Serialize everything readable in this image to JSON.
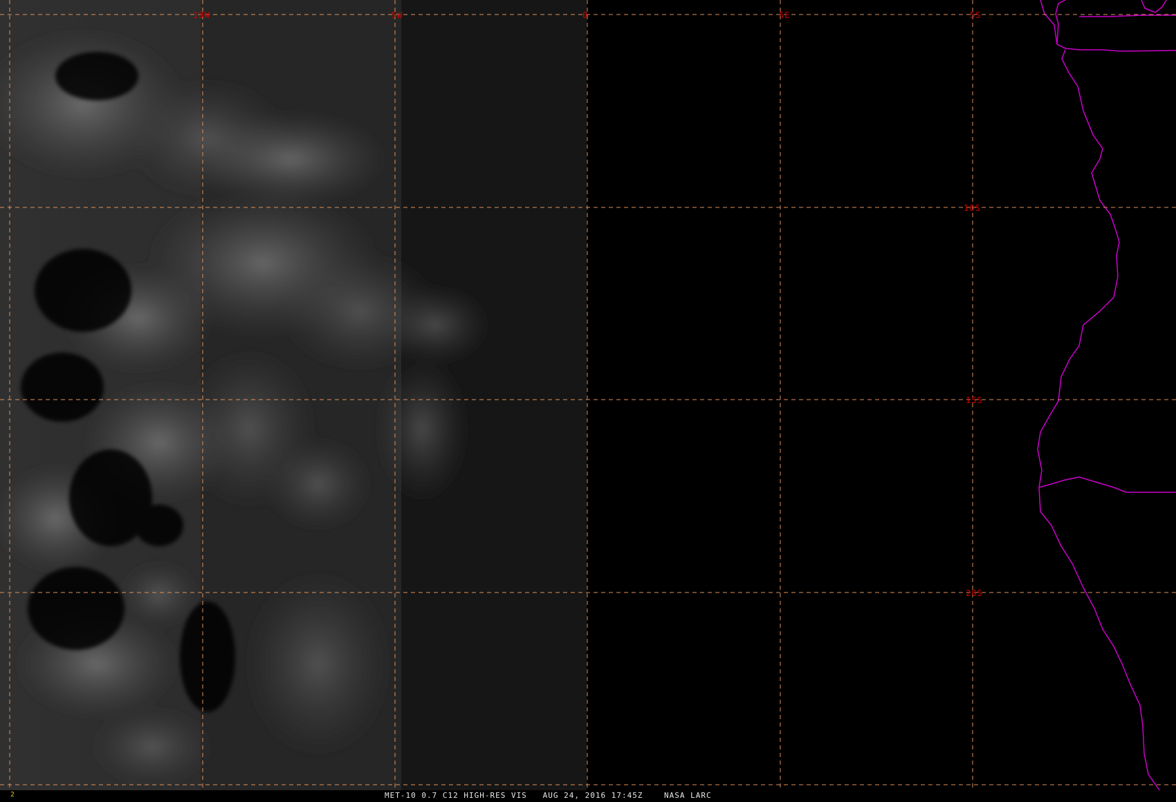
{
  "image": {
    "satellite_caption": "MET-10 0.7 C12 HIGH-RES VIS   AUG 24, 2016 17:45Z    NASA LARC",
    "frame_number": "2"
  },
  "grid": {
    "color": "#e0915a",
    "longitude_labels": [
      "10W",
      "5W",
      "0",
      "5E"
    ],
    "latitude_labels": [
      "5S",
      "10S",
      "15S",
      "20S"
    ],
    "label_color": "#d40000"
  },
  "map_layers": {
    "coastline_color": "#cc00cc",
    "background": "satellite visible imagery (grayscale clouds over ocean)",
    "night_region": "right portion dark (terminator near 0 longitude)"
  }
}
